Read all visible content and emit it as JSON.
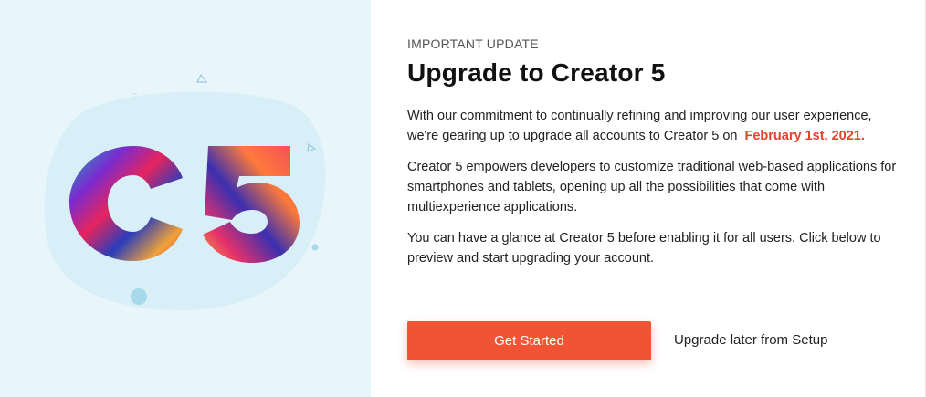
{
  "eyebrow": "IMPORTANT UPDATE",
  "title": "Upgrade to Creator 5",
  "paragraph1_text": "With our commitment to continually refining and improving our user experience, we're gearing up to upgrade all accounts to Creator 5 on",
  "paragraph1_date": "February 1st, 2021.",
  "paragraph2": "Creator 5 empowers developers to customize traditional web-based applications for smartphones and tablets, opening up all the possibilities that come with multiexperience applications.",
  "paragraph3": "You can have a glance at Creator 5 before enabling it for all users. Click below to preview and start upgrading your account.",
  "primary_button": "Get Started",
  "secondary_link": "Upgrade later from Setup",
  "hero_logo_text": "C5",
  "colors": {
    "accent": "#f15434",
    "date": "#e8412a",
    "panel_bg": "#e8f6fb"
  }
}
